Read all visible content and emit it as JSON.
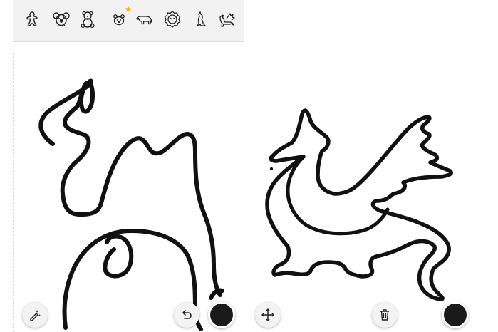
{
  "suggestions": [
    {
      "icon": "gingerbread-icon"
    },
    {
      "icon": "koala-icon"
    },
    {
      "icon": "teddy-bear-icon"
    },
    {
      "icon": "bear-face-icon",
      "starred": true
    },
    {
      "icon": "polar-bear-icon"
    },
    {
      "icon": "lion-face-icon"
    },
    {
      "icon": "kangaroo-icon"
    },
    {
      "icon": "dragon-icon"
    }
  ],
  "toolbar": {
    "left_tools": [
      {
        "icon": "magic-pen-icon"
      },
      {
        "icon": "undo-icon"
      }
    ],
    "right_tools": [
      {
        "icon": "move-icon"
      },
      {
        "icon": "trash-icon"
      }
    ],
    "ink_color": "#1a1a1a"
  },
  "colors": {
    "star": "#f4b400",
    "ink": "#111111",
    "fab_bg": "#f3f3f3"
  }
}
